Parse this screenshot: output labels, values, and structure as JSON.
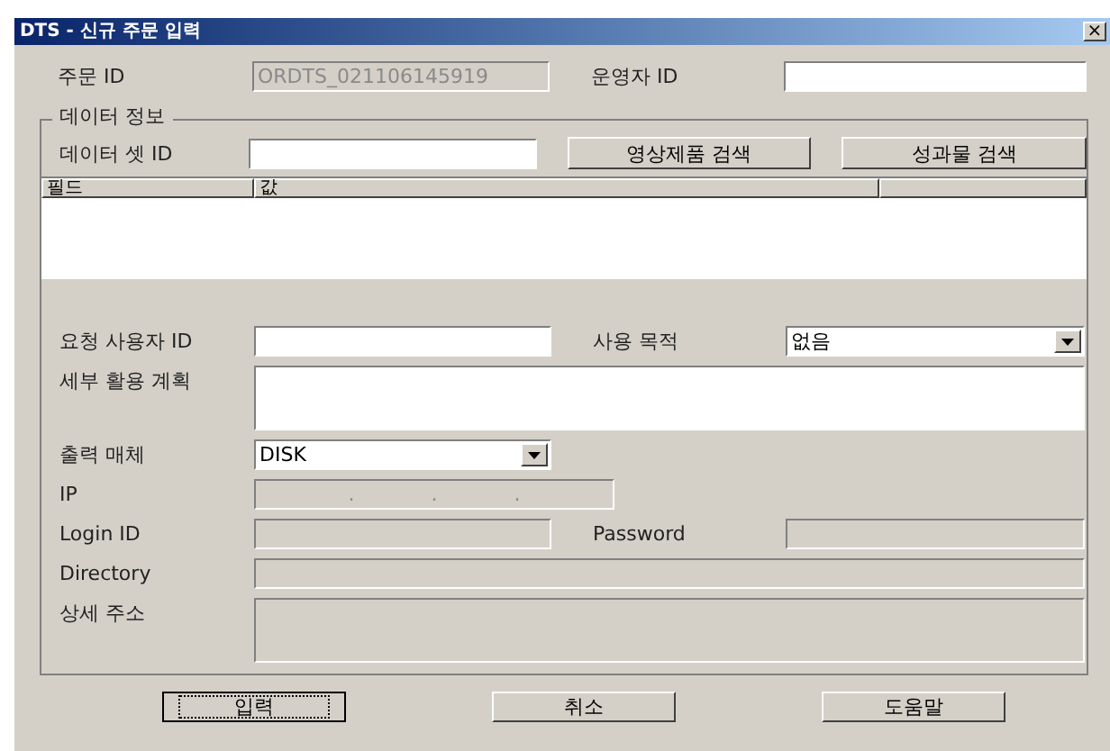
{
  "window": {
    "title": "DTS - 신규 주문 입력",
    "close": "×"
  },
  "order": [
    {
      "label": "주문 ID",
      "value": "ORDTS_021106145919",
      "disabled": true
    },
    {
      "label": "운영자 ID",
      "disabled": false
    }
  ],
  "data_info": {
    "title": "데이터 정보",
    "dataset_id": {
      "label": "데이터 셋 ID",
      "disabled": false
    },
    "buttons": [
      "영상제품 검색",
      "성과물 검색"
    ],
    "table": {
      "columns": [
        "필드",
        "값"
      ]
    }
  },
  "form_rows": [
    [
      {
        "label": "요청 사용자 ID",
        "kind": "text",
        "disabled": false
      },
      {
        "label": "사용 목적",
        "kind": "select",
        "value": "없음",
        "disabled": false
      }
    ],
    [
      {
        "label": "세부 활용 계획",
        "kind": "textarea",
        "disabled": false
      }
    ],
    [
      {
        "label": "출력 매체",
        "kind": "select",
        "value": "DISK",
        "disabled": false
      }
    ],
    [
      {
        "label": "IP",
        "kind": "ip",
        "dots": [
          ".",
          ".",
          "."
        ],
        "disabled": true
      }
    ],
    [
      {
        "label": "Login ID",
        "kind": "text",
        "disabled": true
      },
      {
        "label": "Password",
        "kind": "text",
        "disabled": true
      }
    ],
    [
      {
        "label": "Directory",
        "kind": "wide",
        "disabled": true
      }
    ],
    [
      {
        "label": "상세 주소",
        "kind": "textarea",
        "disabled": true
      }
    ]
  ],
  "buttons": [
    {
      "label": "입력",
      "focused": true
    },
    {
      "label": "취소",
      "focused": false
    },
    {
      "label": "도움말",
      "focused": false
    }
  ]
}
